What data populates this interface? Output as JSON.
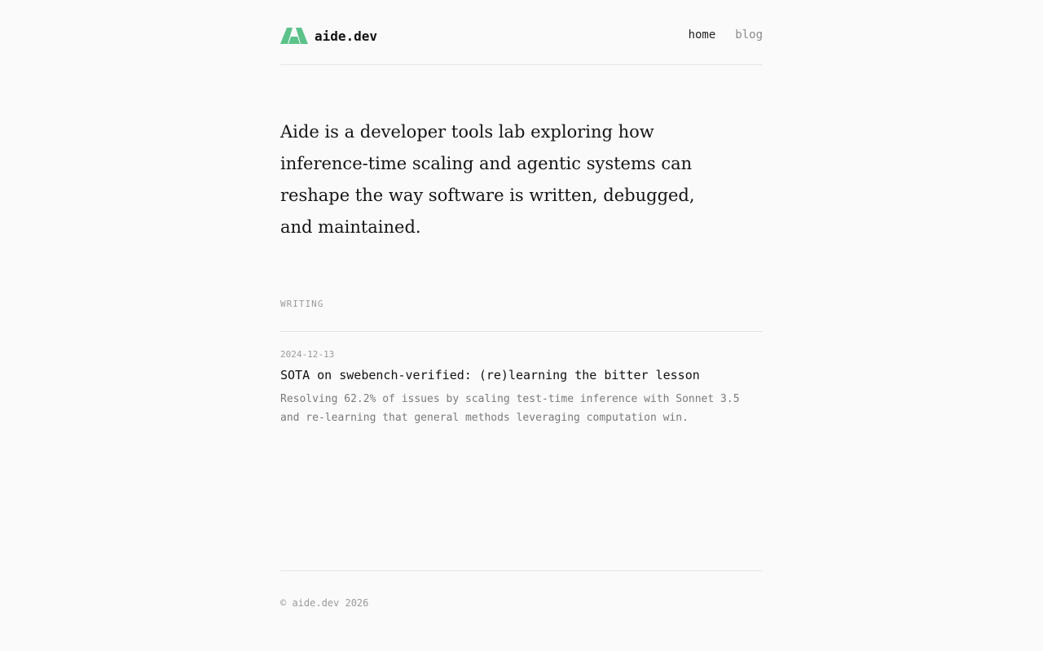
{
  "header": {
    "brand_name": "aide.dev",
    "logo_icon": "aide-logo-icon",
    "nav": [
      {
        "label": "home",
        "active": true
      },
      {
        "label": "blog",
        "active": false
      }
    ]
  },
  "intro": {
    "text": "Aide is a developer tools lab exploring how inference-time scaling and agentic systems can reshape the way software is written, debugged, and maintained."
  },
  "writing": {
    "label": "WRITING",
    "posts": [
      {
        "date": "2024-12-13",
        "title": "SOTA on swebench-verified: (re)learning the bitter lesson",
        "description": "Resolving 62.2% of issues by scaling test-time inference with Sonnet 3.5 and re-learning that general methods leveraging computation win."
      }
    ]
  },
  "footer": {
    "text": "© aide.dev 2026"
  },
  "colors": {
    "background": "#fafafa",
    "logo_green": "#5cc28a",
    "text": "#111111",
    "muted": "#9a9a9a",
    "rule": "#e4e4e4"
  }
}
